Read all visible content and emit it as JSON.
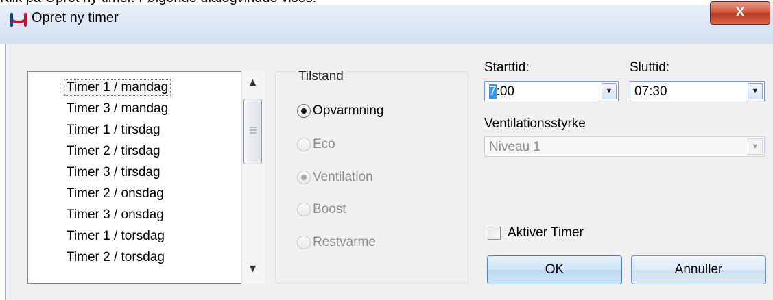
{
  "caption": "Klik på Opret ny timer. Følgende dialogvindue vises:",
  "window": {
    "title": "Opret ny timer",
    "close_glyph": "X",
    "icon": "app-logo-icon"
  },
  "timer_list": {
    "items": [
      "Timer 1 / mandag",
      "Timer 3 / mandag",
      "Timer 1 / tirsdag",
      "Timer 2 / tirsdag",
      "Timer 3 / tirsdag",
      "Timer 2 / onsdag",
      "Timer 3 / onsdag",
      "Timer 1 / torsdag",
      "Timer 2 / torsdag"
    ],
    "selected": "Timer 1 / mandag",
    "scroll_up_glyph": "▲",
    "scroll_down_glyph": "▼"
  },
  "state": {
    "legend": "Tilstand",
    "options": [
      {
        "label": "Opvarmning",
        "checked": true,
        "enabled": true
      },
      {
        "label": "Eco",
        "checked": false,
        "enabled": false
      },
      {
        "label": "Ventilation",
        "checked": true,
        "enabled": false
      },
      {
        "label": "Boost",
        "checked": false,
        "enabled": false
      },
      {
        "label": "Restvarme",
        "checked": false,
        "enabled": false
      }
    ]
  },
  "start": {
    "label": "Starttid:",
    "value_caret": "7",
    "value_rest": ":00"
  },
  "end": {
    "label": "Sluttid:",
    "value": "07:30"
  },
  "ventilation": {
    "label": "Ventilationsstyrke",
    "value": "Niveau 1"
  },
  "activate": {
    "label": "Aktiver Timer",
    "checked": false
  },
  "buttons": {
    "ok": "OK",
    "cancel": "Annuller"
  },
  "dropdown_glyph": "▼",
  "colors": {
    "accent": "#3399ff",
    "close_red": "#c9472e",
    "client_bg": "#f0f0f0"
  }
}
